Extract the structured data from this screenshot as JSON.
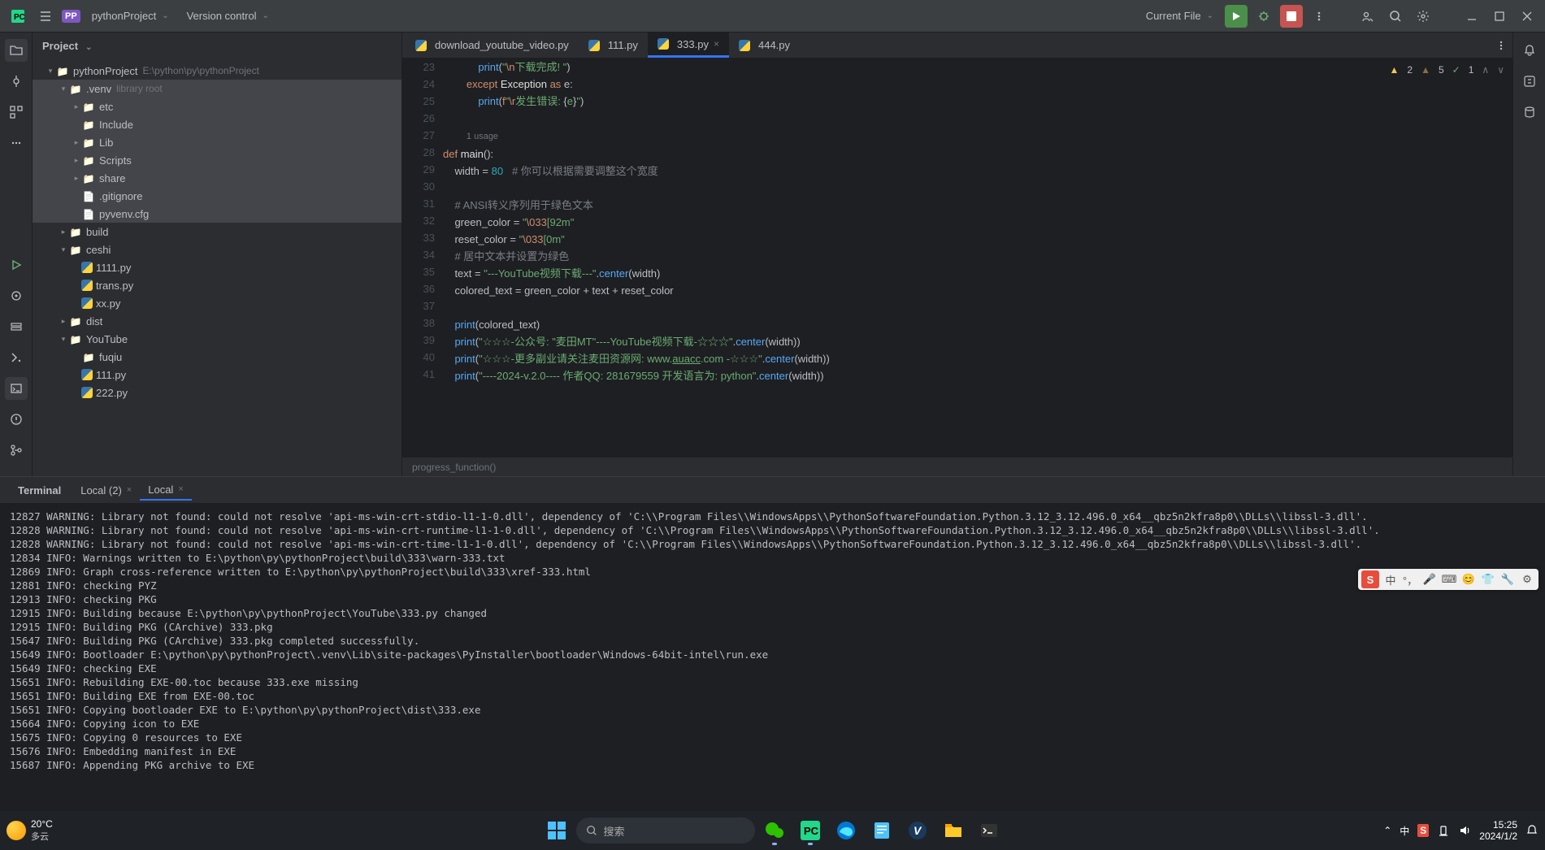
{
  "topbar": {
    "project_name": "pythonProject",
    "version_control": "Version control",
    "run_config": "Current File"
  },
  "project_panel": {
    "title": "Project",
    "root_name": "pythonProject",
    "root_path": "E:\\python\\py\\pythonProject"
  },
  "tree": [
    {
      "indent": 1,
      "arrow": "▾",
      "icon": "folder",
      "label": "pythonProject",
      "hint": "E:\\python\\py\\pythonProject",
      "hl": false
    },
    {
      "indent": 2,
      "arrow": "▾",
      "icon": "folder",
      "label": ".venv",
      "hint": "library root",
      "hl": true
    },
    {
      "indent": 3,
      "arrow": "▸",
      "icon": "folder",
      "label": "etc",
      "hl": true
    },
    {
      "indent": 3,
      "arrow": "",
      "icon": "folder",
      "label": "Include",
      "hl": true
    },
    {
      "indent": 3,
      "arrow": "▸",
      "icon": "folder",
      "label": "Lib",
      "hl": true
    },
    {
      "indent": 3,
      "arrow": "▸",
      "icon": "folder",
      "label": "Scripts",
      "hl": true
    },
    {
      "indent": 3,
      "arrow": "▸",
      "icon": "folder",
      "label": "share",
      "hl": true
    },
    {
      "indent": 3,
      "arrow": "",
      "icon": "file",
      "label": ".gitignore",
      "hl": true
    },
    {
      "indent": 3,
      "arrow": "",
      "icon": "file",
      "label": "pyvenv.cfg",
      "hl": true
    },
    {
      "indent": 2,
      "arrow": "▸",
      "icon": "folder",
      "label": "build",
      "hl": false
    },
    {
      "indent": 2,
      "arrow": "▾",
      "icon": "folder",
      "label": "ceshi",
      "hl": false
    },
    {
      "indent": 3,
      "arrow": "",
      "icon": "py",
      "label": "1111.py",
      "hl": false
    },
    {
      "indent": 3,
      "arrow": "",
      "icon": "py",
      "label": "trans.py",
      "hl": false
    },
    {
      "indent": 3,
      "arrow": "",
      "icon": "py",
      "label": "xx.py",
      "hl": false
    },
    {
      "indent": 2,
      "arrow": "▸",
      "icon": "folder",
      "label": "dist",
      "hl": false
    },
    {
      "indent": 2,
      "arrow": "▾",
      "icon": "folder",
      "label": "YouTube",
      "hl": false
    },
    {
      "indent": 3,
      "arrow": "",
      "icon": "folder",
      "label": "fuqiu",
      "hl": false
    },
    {
      "indent": 3,
      "arrow": "",
      "icon": "py",
      "label": "111.py",
      "hl": false
    },
    {
      "indent": 3,
      "arrow": "",
      "icon": "py",
      "label": "222.py",
      "hl": false
    }
  ],
  "editor_tabs": [
    {
      "label": "download_youtube_video.py",
      "active": false,
      "closable": false
    },
    {
      "label": "111.py",
      "active": false,
      "closable": false
    },
    {
      "label": "333.py",
      "active": true,
      "closable": true
    },
    {
      "label": "444.py",
      "active": false,
      "closable": false
    }
  ],
  "inspections": {
    "warnings": "2",
    "weak": "5",
    "ok": "1"
  },
  "code_usage_hint": "1 usage",
  "code_lines": [
    {
      "n": 23,
      "html": "            <span class='fn'>print</span>(<span class='str'>\"<span class='esc'>\\n</span>下载完成! \"</span>)"
    },
    {
      "n": 24,
      "html": "        <span class='kw'>except</span> <span class='def-name'>Exception</span> <span class='kw'>as</span> e:"
    },
    {
      "n": 25,
      "html": "            <span class='fn'>print</span>(<span class='kw'>f</span><span class='str'>\"<span class='esc'>\\r</span>发生错误: <span class='op'>{</span>e<span class='op'>}</span>\"</span>)"
    },
    {
      "n": 26,
      "html": ""
    },
    {
      "n": "",
      "html": "        <span class='hint'>1 usage</span>"
    },
    {
      "n": 27,
      "html": "<span class='kw'>def</span> <span class='def-name'>main</span>():"
    },
    {
      "n": 28,
      "html": "    width = <span class='num'>80</span>   <span class='com'># 你可以根据需要调整这个宽度</span>"
    },
    {
      "n": 29,
      "html": ""
    },
    {
      "n": 30,
      "html": "    <span class='com'># ANSI转义序列用于绿色文本</span>"
    },
    {
      "n": 31,
      "html": "    green_color = <span class='str'>\"<span class='esc'>\\033</span>[92m\"</span>"
    },
    {
      "n": 32,
      "html": "    reset_color = <span class='str'>\"<span class='esc'>\\033</span>[0m\"</span>"
    },
    {
      "n": 33,
      "html": "    <span class='com'># 居中文本并设置为绿色</span>"
    },
    {
      "n": 34,
      "html": "    text = <span class='str'>\"---YouTube视频下载---\"</span>.<span class='fn'>center</span>(width)"
    },
    {
      "n": 35,
      "html": "    colored_text = green_color + text + reset_color"
    },
    {
      "n": 36,
      "html": ""
    },
    {
      "n": 37,
      "html": "    <span class='fn'>print</span>(colored_text)"
    },
    {
      "n": 38,
      "html": "    <span class='fn'>print</span>(<span class='str'>\"☆☆☆-公众号: \"麦田MT\"----YouTube视频下载-☆☆☆\"</span>.<span class='fn'>center</span>(width))"
    },
    {
      "n": 39,
      "html": "    <span class='fn'>print</span>(<span class='str'>\"☆☆☆-更多副业请关注麦田资源网: www.<u>auacc</u>.com -☆☆☆\"</span>.<span class='fn'>center</span>(width))"
    },
    {
      "n": 40,
      "html": "    <span class='fn'>print</span>(<span class='str'>\"----2024-v.2.0---- 作者QQ: 281679559 开发语言为: python\"</span>.<span class='fn'>center</span>(width))"
    },
    {
      "n": 41,
      "html": ""
    }
  ],
  "breadcrumb": "progress_function()",
  "terminal": {
    "tool_label": "Terminal",
    "tabs": [
      {
        "label": "Local (2)",
        "active": false
      },
      {
        "label": "Local",
        "active": true
      }
    ],
    "lines": [
      "12827 WARNING: Library not found: could not resolve 'api-ms-win-crt-stdio-l1-1-0.dll', dependency of 'C:\\\\Program Files\\\\WindowsApps\\\\PythonSoftwareFoundation.Python.3.12_3.12.496.0_x64__qbz5n2kfra8p0\\\\DLLs\\\\libssl-3.dll'.",
      "12828 WARNING: Library not found: could not resolve 'api-ms-win-crt-runtime-l1-1-0.dll', dependency of 'C:\\\\Program Files\\\\WindowsApps\\\\PythonSoftwareFoundation.Python.3.12_3.12.496.0_x64__qbz5n2kfra8p0\\\\DLLs\\\\libssl-3.dll'.",
      "12828 WARNING: Library not found: could not resolve 'api-ms-win-crt-time-l1-1-0.dll', dependency of 'C:\\\\Program Files\\\\WindowsApps\\\\PythonSoftwareFoundation.Python.3.12_3.12.496.0_x64__qbz5n2kfra8p0\\\\DLLs\\\\libssl-3.dll'.",
      "12834 INFO: Warnings written to E:\\python\\py\\pythonProject\\build\\333\\warn-333.txt",
      "12869 INFO: Graph cross-reference written to E:\\python\\py\\pythonProject\\build\\333\\xref-333.html",
      "12881 INFO: checking PYZ",
      "12913 INFO: checking PKG",
      "12915 INFO: Building because E:\\python\\py\\pythonProject\\YouTube\\333.py changed",
      "12915 INFO: Building PKG (CArchive) 333.pkg",
      "15647 INFO: Building PKG (CArchive) 333.pkg completed successfully.",
      "15649 INFO: Bootloader E:\\python\\py\\pythonProject\\.venv\\Lib\\site-packages\\PyInstaller\\bootloader\\Windows-64bit-intel\\run.exe",
      "15649 INFO: checking EXE",
      "15651 INFO: Rebuilding EXE-00.toc because 333.exe missing",
      "15651 INFO: Building EXE from EXE-00.toc",
      "15651 INFO: Copying bootloader EXE to E:\\python\\py\\pythonProject\\dist\\333.exe",
      "15664 INFO: Copying icon to EXE",
      "15675 INFO: Copying 0 resources to EXE",
      "15676 INFO: Embedding manifest in EXE",
      "15687 INFO: Appending PKG archive to EXE"
    ]
  },
  "taskbar": {
    "weather_temp": "20°C",
    "weather_desc": "多云",
    "search_placeholder": "搜索",
    "time": "15:25",
    "date": "2024/1/2"
  },
  "ime": {
    "logo_text": "S",
    "lang": "中"
  }
}
